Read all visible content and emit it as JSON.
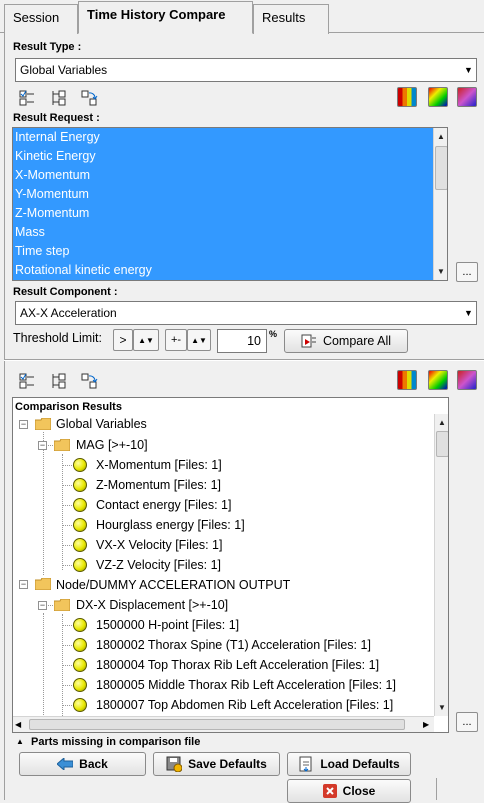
{
  "tabs": [
    {
      "label": "Session"
    },
    {
      "label": "Time History Compare"
    },
    {
      "label": "Results"
    }
  ],
  "result_type": {
    "label": "Result Type :",
    "value": "Global Variables"
  },
  "result_request": {
    "label": "Result Request :",
    "items": [
      "Internal Energy",
      "Kinetic Energy",
      "X-Momentum",
      "Y-Momentum",
      "Z-Momentum",
      "Mass",
      "Time step",
      "Rotational kinetic energy"
    ],
    "more_button": "..."
  },
  "result_component": {
    "label": "Result Component :",
    "value": "AX-X Acceleration"
  },
  "threshold": {
    "label": "Threshold Limit:",
    "op1": ">",
    "op2": "+-",
    "value": "10",
    "unit": "%",
    "compare_all": "Compare All"
  },
  "comparison": {
    "header": "Comparison Results",
    "nodes": [
      {
        "text": "Global Variables"
      },
      {
        "text": "MAG [>+-10]"
      },
      {
        "text": "X-Momentum [Files: 1]"
      },
      {
        "text": "Z-Momentum [Files: 1]"
      },
      {
        "text": "Contact energy [Files: 1]"
      },
      {
        "text": "Hourglass energy [Files: 1]"
      },
      {
        "text": "VX-X Velocity [Files: 1]"
      },
      {
        "text": "VZ-Z Velocity [Files: 1]"
      },
      {
        "text": "Node/DUMMY ACCELERATION OUTPUT"
      },
      {
        "text": "DX-X Displacement [>+-10]"
      },
      {
        "text": "1500000 H-point [Files: 1]"
      },
      {
        "text": "1800002 Thorax Spine (T1) Acceleration [Files: 1]"
      },
      {
        "text": "1800004 Top Thorax Rib Left Acceleration [Files: 1]"
      },
      {
        "text": "1800005 Middle Thorax Rib Left Acceleration [Files: 1]"
      },
      {
        "text": "1800007 Top Abdomen Rib Left Acceleration [Files: 1]"
      }
    ],
    "more_button": "..."
  },
  "parts_missing": "Parts missing in comparison file",
  "buttons": {
    "back": "Back",
    "save_defaults": "Save Defaults",
    "load_defaults": "Load Defaults",
    "close": "Close"
  },
  "colors": {
    "selection": "#3399ff",
    "ball": "#e8e800",
    "folder": "#f2c55c"
  }
}
